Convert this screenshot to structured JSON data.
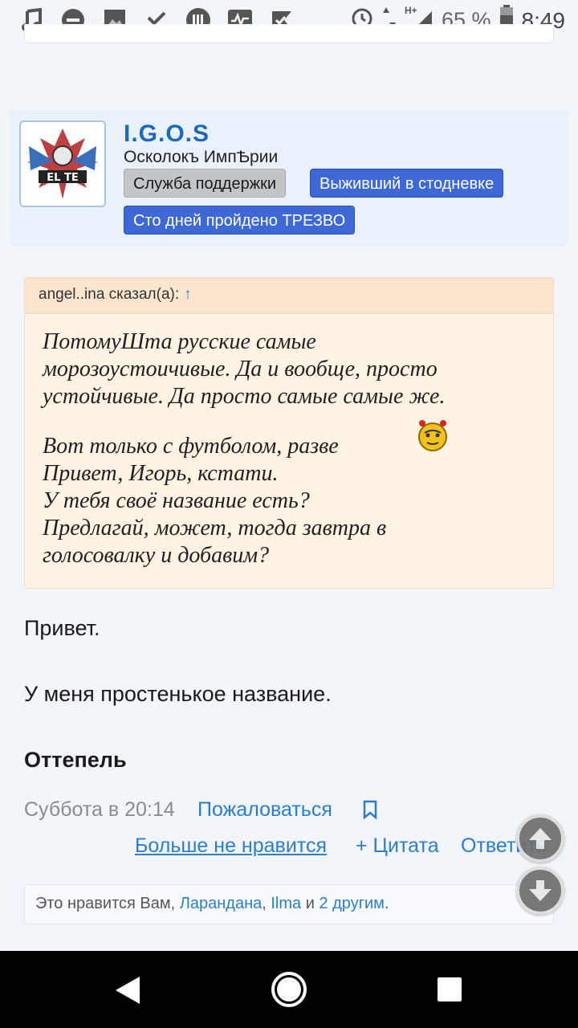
{
  "status_bar": {
    "battery": "65 %",
    "time": "8:49",
    "network": "H+",
    "icons_left": [
      "music-note-icon",
      "do-not-disturb-icon",
      "image-icon",
      "download-done-icon",
      "app-icon",
      "activity-icon",
      "check-icon"
    ],
    "icons_right": [
      "alarm-icon",
      "data-arrows-icon",
      "signal-icon",
      "battery-icon"
    ]
  },
  "user": {
    "name": "I.G.O.S",
    "title": "Осколокъ ИмпѢрии",
    "badges": [
      {
        "label": "Служба поддержки",
        "style": "grey"
      },
      {
        "label": "Выживший в стодневке",
        "style": "blue"
      },
      {
        "label": "Сто дней пройдено ТРЕЗВО",
        "style": "blue"
      }
    ]
  },
  "quote": {
    "author_line": "angel..ina сказал(а):",
    "jump_arrow": "↑",
    "lines": [
      "ПотомуШта русские самые",
      "морозоустоичивые. Да и вообще, просто",
      "устойчивые. Да просто самые самые же.",
      "Вот только с футболом, разве",
      "Привет, Игорь, кстати.",
      "У тебя своё название есть?",
      "Предлагай, может, тогда завтра в",
      "голосовалку и добавим?"
    ]
  },
  "message": {
    "line1": "Привет.",
    "line2": "У меня простенькое название.",
    "line3": "Оттепель"
  },
  "post_meta": {
    "date": "Суббота в 20:14",
    "report": "Пожаловаться"
  },
  "actions": {
    "unlike": "Больше не нравится",
    "quote": "+ Цитата",
    "reply": "Ответить"
  },
  "likes": {
    "prefix": "Это нравится Вам,",
    "user1": "Ларандана",
    "sep1": ",",
    "user2": "Ilma",
    "and": "и",
    "others": "2 другим",
    "end": "."
  },
  "colors": {
    "link": "#2a7ed1",
    "username": "#1d6bb7",
    "badge_blue": "#3e68d6",
    "badge_grey": "#c3c6c9",
    "quote_bg": "#fff4e3",
    "page_bg": "#f2f5f9"
  }
}
